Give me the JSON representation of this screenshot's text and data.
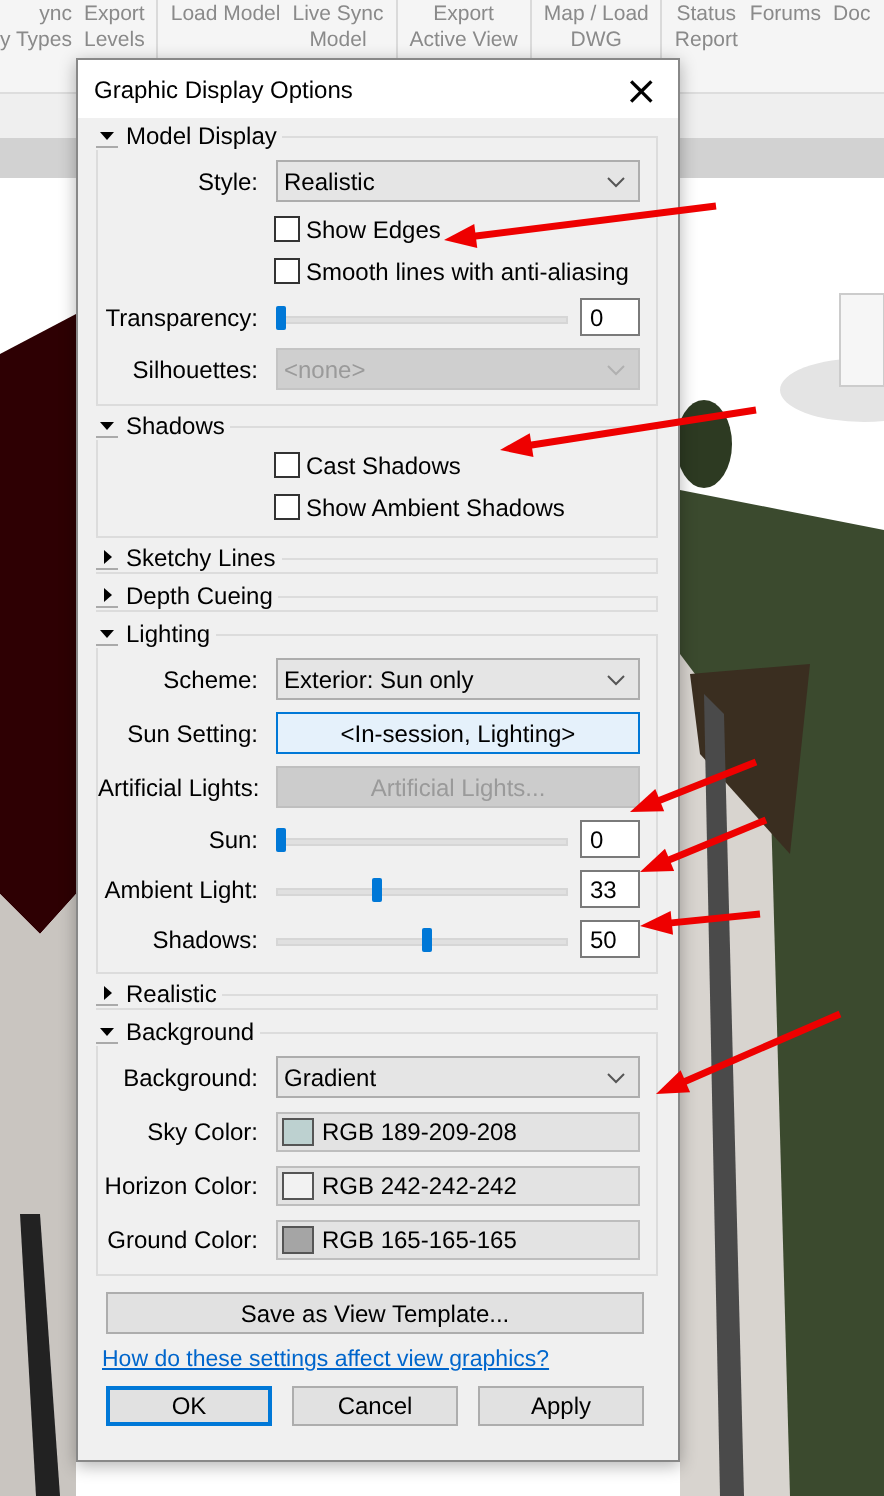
{
  "ribbon": {
    "groups": [
      [
        {
          "lines": [
            "ync",
            "y Types"
          ]
        },
        {
          "lines": [
            "Export",
            "Levels"
          ]
        }
      ],
      [
        {
          "lines": [
            "Load Model"
          ]
        },
        {
          "lines": [
            "Live Sync",
            "Model"
          ]
        }
      ],
      [
        {
          "lines": [
            "Export",
            "Active View"
          ]
        }
      ],
      [
        {
          "lines": [
            "Map / Load",
            "DWG"
          ]
        }
      ],
      [
        {
          "lines": [
            "Status",
            "Report"
          ]
        },
        {
          "lines": [
            "Forums"
          ]
        },
        {
          "lines": [
            "Doc"
          ]
        }
      ]
    ]
  },
  "dialog": {
    "title": "Graphic Display Options",
    "close": "×",
    "sections": [
      {
        "title": "Model Display",
        "expanded": true,
        "rows": [
          {
            "kind": "dropdown",
            "label": "Style:",
            "value": "Realistic",
            "disabled": false
          },
          {
            "kind": "checkbox",
            "label": "Show Edges",
            "checked": false
          },
          {
            "kind": "checkbox",
            "label": "Smooth lines with anti-aliasing",
            "checked": false
          },
          {
            "kind": "slider",
            "label": "Transparency:",
            "level": 0,
            "value": "0"
          },
          {
            "kind": "dropdown",
            "label": "Silhouettes:",
            "value": "<none>",
            "disabled": true
          }
        ]
      },
      {
        "title": "Shadows",
        "expanded": true,
        "rows": [
          {
            "kind": "checkbox",
            "label": "Cast Shadows",
            "checked": false
          },
          {
            "kind": "checkbox",
            "label": "Show Ambient Shadows",
            "checked": false
          }
        ]
      },
      {
        "title": "Sketchy Lines",
        "expanded": false
      },
      {
        "title": "Depth Cueing",
        "expanded": false
      },
      {
        "title": "Lighting",
        "expanded": true,
        "rows": [
          {
            "kind": "dropdown",
            "label": "Scheme:",
            "value": "Exterior: Sun only",
            "disabled": false
          },
          {
            "kind": "button",
            "label": "Sun Setting:",
            "text": "<In-session, Lighting>",
            "highlighted": true,
            "disabled": false
          },
          {
            "kind": "button",
            "label": "Artificial Lights:",
            "text": "Artificial Lights...",
            "highlighted": false,
            "disabled": true
          },
          {
            "kind": "slider",
            "label": "Sun:",
            "level": 0,
            "value": "0"
          },
          {
            "kind": "slider",
            "label": "Ambient Light:",
            "level": 0.33,
            "value": "33"
          },
          {
            "kind": "slider",
            "label": "Shadows:",
            "level": 0.5,
            "value": "50"
          }
        ]
      },
      {
        "title": "Realistic",
        "expanded": false
      },
      {
        "title": "Background",
        "expanded": true,
        "rows": [
          {
            "kind": "dropdown",
            "label": "Background:",
            "value": "Gradient",
            "disabled": false
          },
          {
            "kind": "color",
            "label": "Sky Color:",
            "text": "RGB 189-209-208",
            "color": "#bdd1d0"
          },
          {
            "kind": "color",
            "label": "Horizon Color:",
            "text": "RGB 242-242-242",
            "color": "#f2f2f2"
          },
          {
            "kind": "color",
            "label": "Ground Color:",
            "text": "RGB 165-165-165",
            "color": "#a5a5a5"
          }
        ]
      }
    ],
    "save_button": "Save as View Template...",
    "help_link": "How do these settings affect view graphics?",
    "buttons": [
      {
        "label": "OK",
        "default": true
      },
      {
        "label": "Cancel",
        "default": false
      },
      {
        "label": "Apply",
        "default": false
      }
    ]
  }
}
